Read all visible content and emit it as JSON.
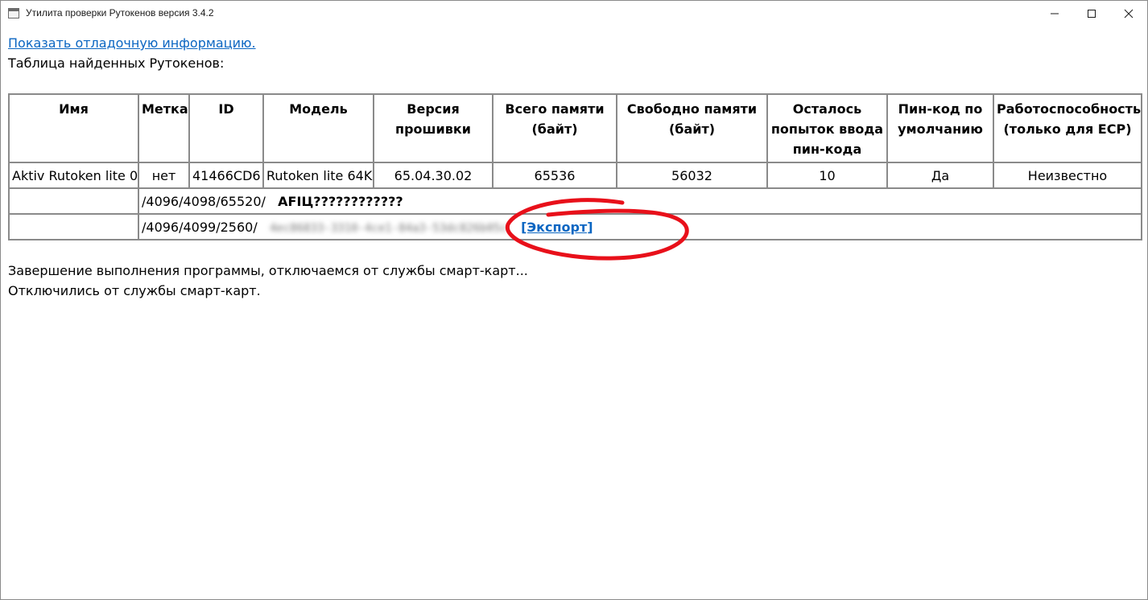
{
  "window": {
    "title": "Утилита проверки Рутокенов версия 3.4.2",
    "controls": [
      "minimize-icon",
      "maximize-icon",
      "close-icon"
    ]
  },
  "content": {
    "debug_link": "Показать отладочную информацию.",
    "found_label": "Таблица найденных Рутокенов:",
    "table": {
      "headers": [
        "Имя",
        "Метка",
        "ID",
        "Модель",
        "Версия прошивки",
        "Всего памяти (байт)",
        "Свободно памяти (байт)",
        "Осталось попыток ввода пин-кода",
        "Пин-код по умолчанию",
        "Работоспособность (только для ЕСР)"
      ],
      "row": [
        "Aktiv Rutoken lite 0",
        "нет",
        "41466CD6",
        "Rutoken lite 64K",
        "65.04.30.02",
        "65536",
        "56032",
        "10",
        "Да",
        "Неизвестно"
      ],
      "sub_rows": [
        {
          "path": "/4096/4098/65520/",
          "value": "AFIЦ????????????"
        },
        {
          "path": "/4096/4099/2560/",
          "value": "4ec86833-3310-4ce1-84a3-53dc826b05c",
          "export_label": "[Экспорт]"
        }
      ]
    },
    "log": [
      "Завершение выполнения программы, отключаемся от службы смарт-карт...",
      "Отключились от службы смарт-карт."
    ]
  },
  "colors": {
    "link": "#0b66c2",
    "border": "#8a8a8a",
    "annotation": "#e8101a"
  }
}
